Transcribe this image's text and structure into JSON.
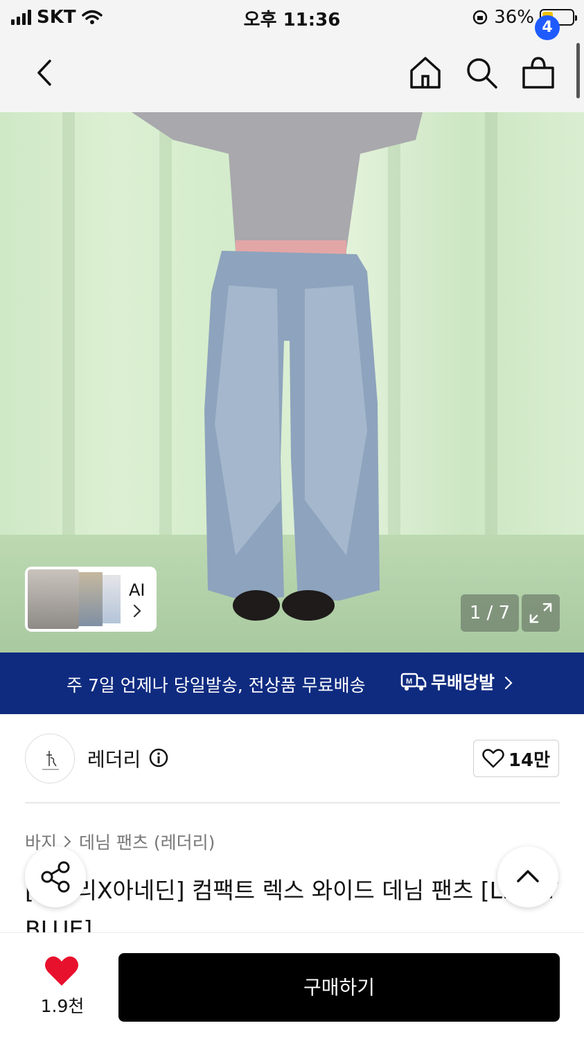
{
  "status_bar": {
    "carrier": "SKT",
    "time": "오후 11:36",
    "battery_percent": "36%",
    "battery_level": 0.36
  },
  "nav": {
    "cart_count": "4",
    "icons": [
      "back-icon",
      "home-icon",
      "search-icon",
      "cart-icon"
    ]
  },
  "gallery": {
    "ai_label": "AI",
    "pager": "1 / 7"
  },
  "promo": {
    "text": "주 7일 언제나 당일발송, 전상품 무료배송",
    "brand": "무배당발"
  },
  "brand": {
    "name": "레더리",
    "likes": "14만"
  },
  "breadcrumb": {
    "category": "바지",
    "subcategory": "데님 팬츠 (레더리)"
  },
  "product": {
    "title": "[레더리X아네딘] 컴팩트 렉스 와이드 데님 팬츠 [LIGHT BLUE]"
  },
  "bottom": {
    "like_count": "1.9천",
    "buy_label": "구매하기"
  },
  "colors": {
    "accent_blue": "#1f5bff",
    "promo_bg": "#0f2b80",
    "heart_red": "#e8112d",
    "buy_bg": "#000000"
  }
}
